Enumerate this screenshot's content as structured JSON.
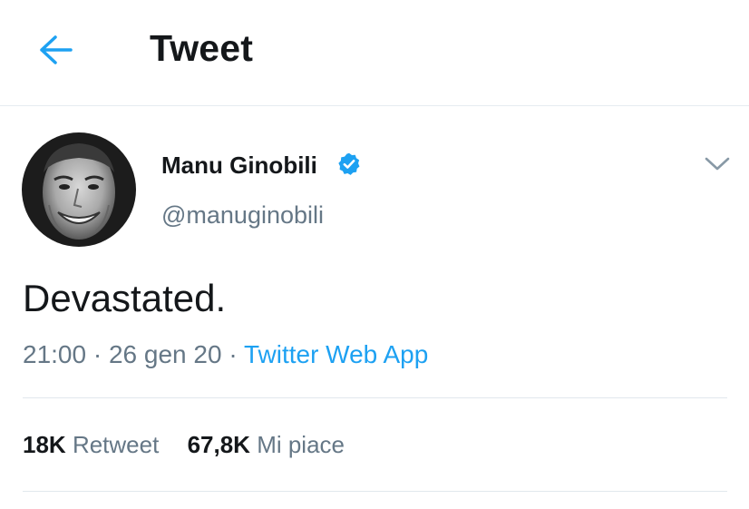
{
  "header": {
    "back_icon": "arrow-left-icon",
    "title": "Tweet"
  },
  "tweet": {
    "author_name": "Manu Ginobili",
    "verified_icon": "verified-badge-icon",
    "handle": "@manuginobili",
    "more_icon": "chevron-down-icon",
    "text": "Devastated.",
    "time": "21:00",
    "date": "26 gen 20",
    "separator": "·",
    "source": "Twitter Web App"
  },
  "stats": {
    "retweets_count": "18K",
    "retweets_label": "Retweet",
    "likes_count": "67,8K",
    "likes_label": "Mi piace"
  },
  "colors": {
    "accent": "#1da1f2",
    "text_primary": "#14171a",
    "text_secondary": "#657786",
    "divider": "#e1e8ed"
  }
}
